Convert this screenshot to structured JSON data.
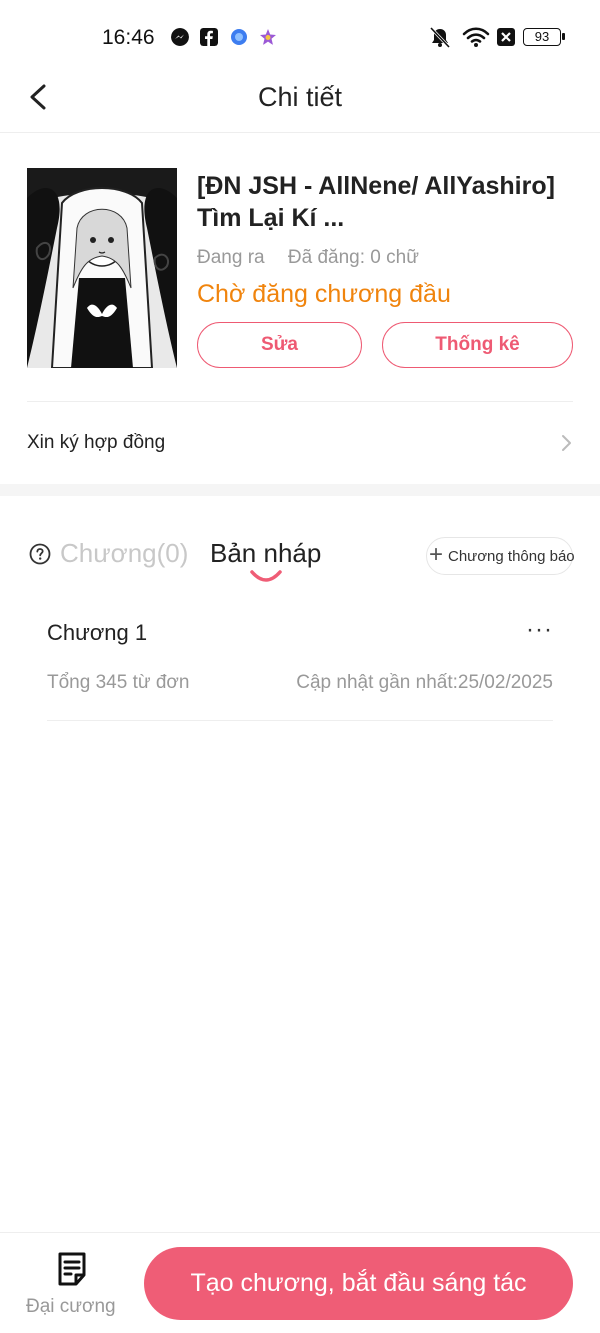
{
  "status_bar": {
    "time": "16:46",
    "battery": "93",
    "app_icons": [
      "messenger-icon",
      "facebook-icon",
      "app-icon-blue",
      "app-icon-star"
    ],
    "system_icons": [
      "silent-bell-icon",
      "wifi-icon",
      "sim-off-icon",
      "battery-icon"
    ]
  },
  "header": {
    "title": "Chi tiết",
    "back_icon": "chevron-left-icon"
  },
  "book": {
    "title": "[ĐN JSH - AllNene/ AllYashiro] Tìm Lại Kí ...",
    "state": "Đang ra",
    "published": "Đã đăng: 0 chữ",
    "status": "Chờ đăng chương đầu",
    "edit_label": "Sửa",
    "stats_label": "Thống kê"
  },
  "contract": {
    "label": "Xin ký hợp đồng"
  },
  "tabs": {
    "chapters_label": "Chương(0)",
    "drafts_label": "Bản nháp",
    "announce_label": "Chương thông báo",
    "announce_plus": "+"
  },
  "drafts": [
    {
      "title": "Chương 1",
      "words": "Tổng 345 từ đơn",
      "updated": "Cập nhật gần nhất:25/02/2025",
      "more": "···"
    }
  ],
  "bottom": {
    "outline_label": "Đại cương",
    "create_label": "Tạo chương, bắt đầu sáng tác"
  },
  "colors": {
    "accent": "#ef5d76",
    "status_orange": "#f0840d",
    "muted": "#999999"
  }
}
